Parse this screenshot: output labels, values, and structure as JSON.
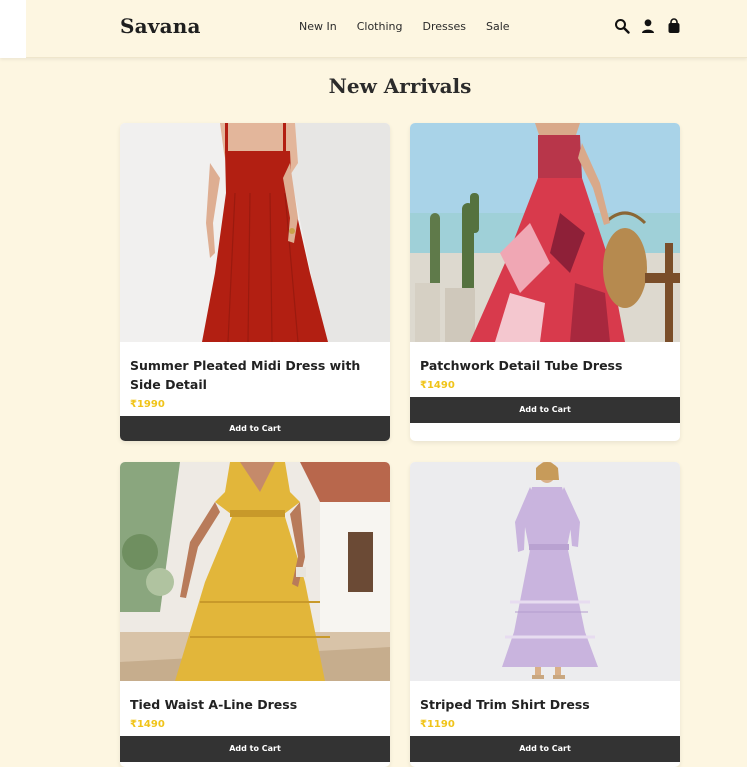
{
  "header": {
    "brand": "Savana",
    "nav": [
      "New In",
      "Clothing",
      "Dresses",
      "Sale"
    ],
    "icons": [
      "search-icon",
      "user-icon",
      "bag-icon"
    ]
  },
  "main": {
    "title": "New Arrivals",
    "products": [
      {
        "name": "Summer Pleated Midi Dress with Side Detail",
        "price": "₹1990",
        "button": "Add to Cart",
        "dress_color": "#b21f12"
      },
      {
        "name": "Patchwork Detail Tube Dress",
        "price": "₹1490",
        "button": "Add to Cart",
        "dress_color": "#d83a4c"
      },
      {
        "name": "Tied Waist A-Line Dress",
        "price": "₹1490",
        "button": "Add to Cart",
        "dress_color": "#e2b63a"
      },
      {
        "name": "Striped Trim Shirt Dress",
        "price": "₹1190",
        "button": "Add to Cart",
        "dress_color": "#c9b4de"
      }
    ]
  },
  "colors": {
    "background": "#fdf6e1",
    "price": "#f0c419",
    "button": "#333333"
  }
}
